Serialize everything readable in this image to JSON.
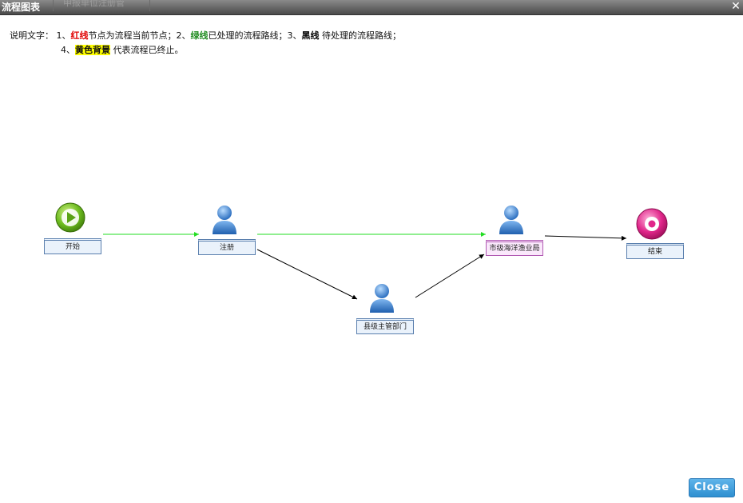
{
  "window": {
    "title": "流程图表",
    "background_tab": "申报单位注册管"
  },
  "legend": {
    "prefix": "说明文字：",
    "n1": "1、",
    "red_text": "红线",
    "red_desc": "节点为流程当前节点；",
    "n2": "2、",
    "green_text": "绿线",
    "green_desc": "已处理的流程路线；",
    "n3": "3、",
    "black_text": "黑线",
    "black_desc": " 待处理的流程路线；",
    "n4": "4、",
    "yellow_text": "黄色背景",
    "yellow_desc": " 代表流程已终止。"
  },
  "nodes": {
    "start": {
      "label": "开始",
      "icon": "start-play-icon"
    },
    "register": {
      "label": "注册",
      "icon": "user-icon"
    },
    "county": {
      "label": "县级主管部门",
      "icon": "user-icon"
    },
    "city": {
      "label": "市级海洋渔业局",
      "icon": "user-icon"
    },
    "end": {
      "label": "结束",
      "icon": "end-stop-icon"
    }
  },
  "edges": [
    {
      "from": "start",
      "to": "register",
      "status": "processed",
      "color": "#22dd22"
    },
    {
      "from": "register",
      "to": "city",
      "status": "processed",
      "color": "#22dd22"
    },
    {
      "from": "register",
      "to": "county",
      "status": "pending",
      "color": "#000000"
    },
    {
      "from": "county",
      "to": "city",
      "status": "pending",
      "color": "#000000"
    },
    {
      "from": "city",
      "to": "end",
      "status": "pending",
      "color": "#000000"
    }
  ],
  "colors": {
    "processed": "#22dd22",
    "pending": "#000000",
    "current_node_border": "#b15ab3",
    "button": "#3a9ddf"
  },
  "buttons": {
    "close": "Close"
  }
}
